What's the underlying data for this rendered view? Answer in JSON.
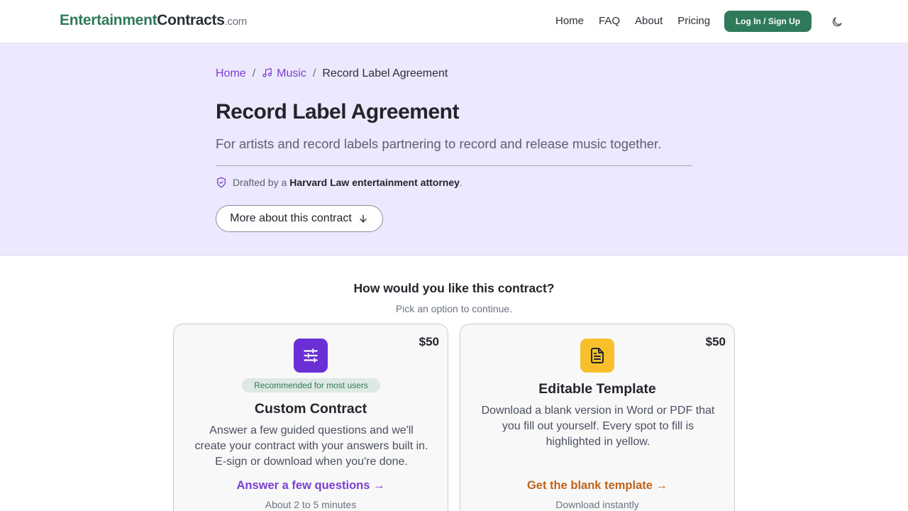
{
  "header": {
    "logo": {
      "part1": "Entertainment",
      "part2": "Contracts",
      "part3": ".com"
    },
    "nav": [
      {
        "label": "Home"
      },
      {
        "label": "FAQ"
      },
      {
        "label": "About"
      },
      {
        "label": "Pricing"
      }
    ],
    "login_label": "Log In / Sign Up",
    "theme_icon": "moon-icon"
  },
  "hero": {
    "breadcrumb": {
      "home": "Home",
      "category": "Music",
      "category_icon": "music-note-icon",
      "current": "Record Label Agreement",
      "separator": "/"
    },
    "title": "Record Label Agreement",
    "subtitle": "For artists and record labels partnering to record and release music together.",
    "drafted_prefix": "Drafted by a",
    "drafted_bold": "Harvard Law entertainment attorney",
    "drafted_suffix": ".",
    "more_label": "More about this contract"
  },
  "choice": {
    "question": "How would you like this contract?",
    "hint": "Pick an option to continue.",
    "cards": [
      {
        "price": "$50",
        "icon": "sliders-icon",
        "badge": "Recommended for most users",
        "title": "Custom Contract",
        "description": "Answer a few guided questions and we'll create your contract with your answers built in. E-sign or download when you're done.",
        "cta": "Answer a few questions →",
        "note": "About 2 to 5 minutes"
      },
      {
        "price": "$50",
        "icon": "document-icon",
        "title": "Editable Template",
        "description": "Download a blank version in Word or PDF that you fill out yourself. Every spot to fill is highlighted in yellow.",
        "cta": "Get the blank template →",
        "note": "Download instantly"
      }
    ]
  },
  "colors": {
    "brand_green": "#2f7a5a",
    "accent_purple": "#7a3fd1",
    "hero_bg": "#ece8fd",
    "template_yellow": "#f7c02b",
    "template_orange": "#c0641a"
  }
}
